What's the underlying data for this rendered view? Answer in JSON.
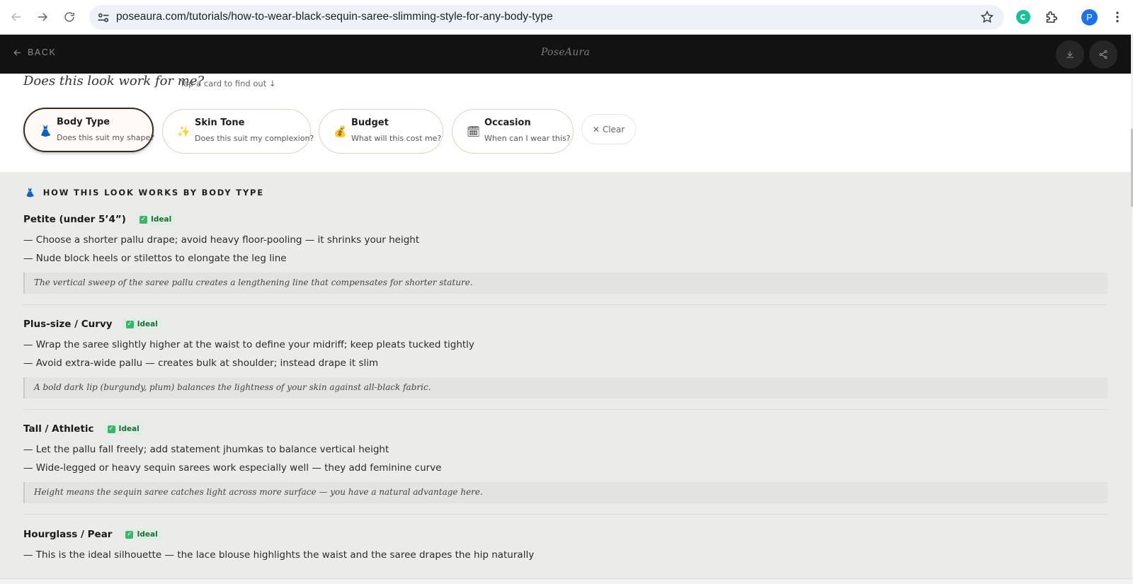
{
  "browser": {
    "url": "poseaura.com/tutorials/how-to-wear-black-sequin-saree-slimming-style-for-any-body-type",
    "profile_initial": "P"
  },
  "header": {
    "back_label": "BACK",
    "brand": "PoseAura"
  },
  "question": {
    "title": "Does this look work for me?",
    "hint": "Tap a card to find out ↓",
    "cards": [
      {
        "icon": "dress-icon",
        "emoji": "👗",
        "title": "Body Type",
        "subtitle": "Does this suit my shape?",
        "active": true
      },
      {
        "icon": "sparkle-icon",
        "emoji": "✨",
        "title": "Skin Tone",
        "subtitle": "Does this suit my complexion?",
        "active": false
      },
      {
        "icon": "money-bag-icon",
        "emoji": "💰",
        "title": "Budget",
        "subtitle": "What will this cost me?",
        "active": false
      },
      {
        "icon": "calendar-icon",
        "emoji": "🗓",
        "title": "Occasion",
        "subtitle": "When can I wear this?",
        "active": false
      }
    ],
    "clear_label": "Clear"
  },
  "section": {
    "heading": "HOW THIS LOOK WORKS BY BODY TYPE",
    "badge_label": "Ideal",
    "dash": "—",
    "blocks": [
      {
        "name": "Petite (under 5’4”)",
        "tips": [
          "Choose a shorter pallu drape; avoid heavy floor-pooling — it shrinks your height",
          "Nude block heels or stilettos to elongate the leg line"
        ],
        "note": "The vertical sweep of the saree pallu creates a lengthening line that compensates for shorter stature."
      },
      {
        "name": "Plus-size / Curvy",
        "tips": [
          "Wrap the saree slightly higher at the waist to define your midriff; keep pleats tucked tightly",
          "Avoid extra-wide pallu — creates bulk at shoulder; instead drape it slim"
        ],
        "note": "A bold dark lip (burgundy, plum) balances the lightness of your skin against all-black fabric."
      },
      {
        "name": "Tall / Athletic",
        "tips": [
          "Let the pallu fall freely; add statement jhumkas to balance vertical height",
          "Wide-legged or heavy sequin sarees work especially well — they add feminine curve"
        ],
        "note": "Height means the sequin saree catches light across more surface — you have a natural advantage here."
      },
      {
        "name": "Hourglass / Pear",
        "tips": [
          "This is the ideal silhouette — the lace blouse highlights the waist and the saree drapes the hip naturally"
        ]
      }
    ]
  }
}
